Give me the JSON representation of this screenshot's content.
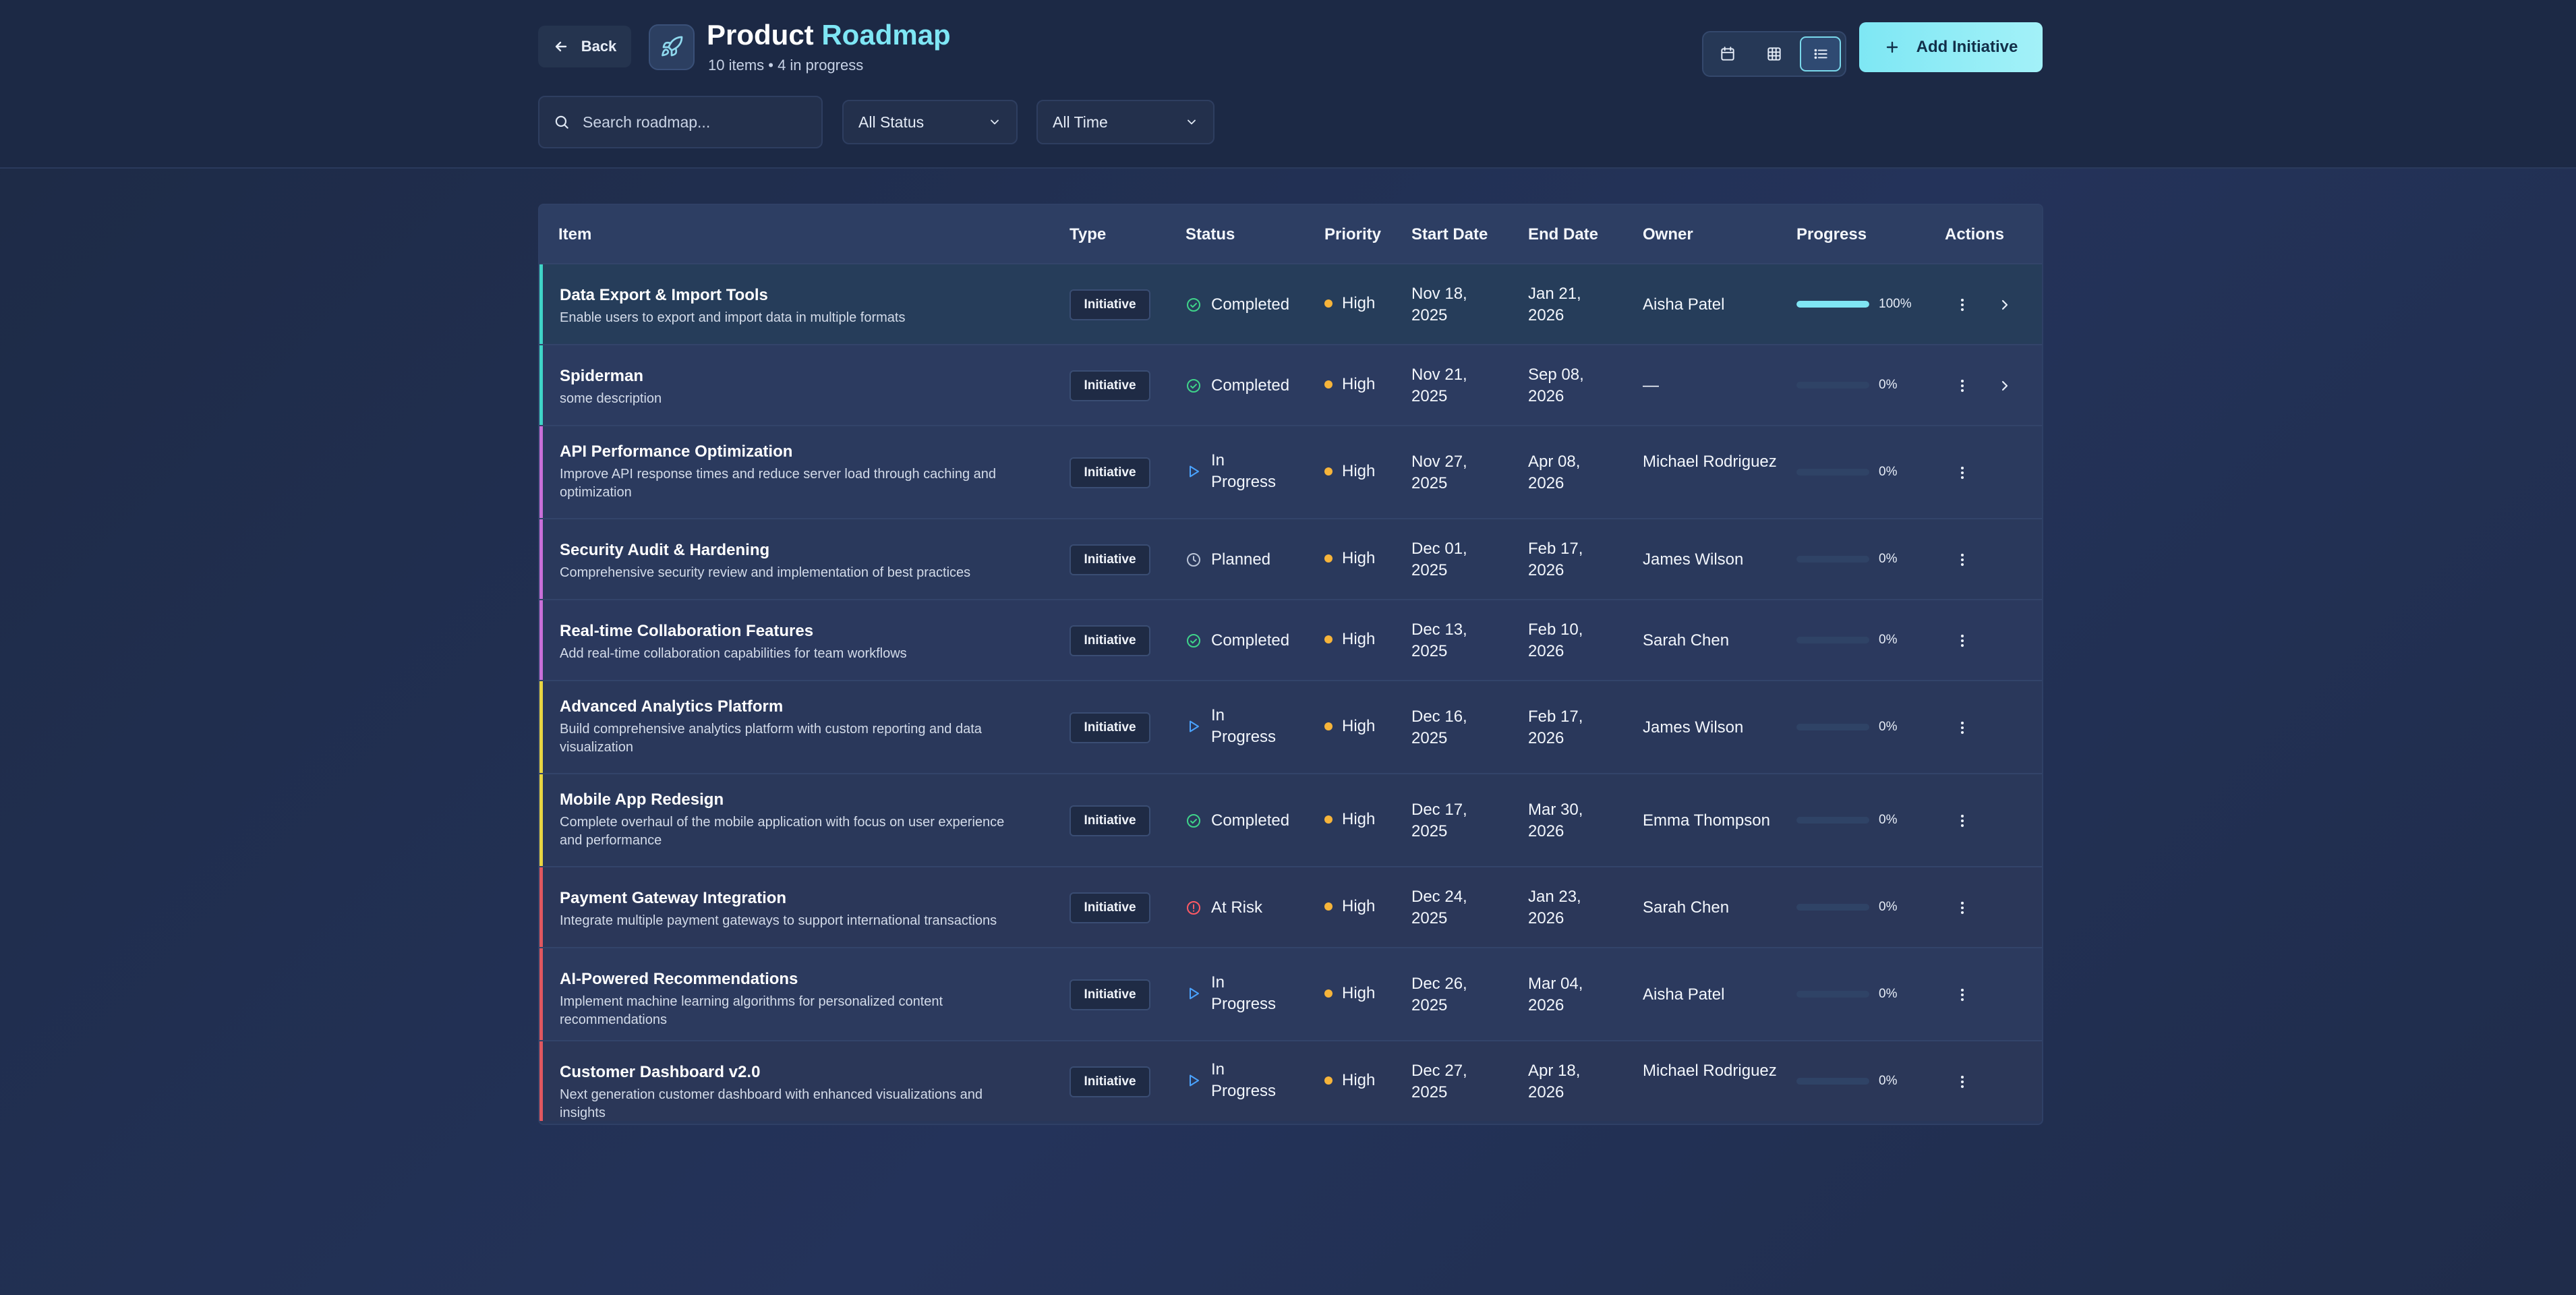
{
  "header": {
    "back_label": "Back",
    "title_main": "Product",
    "title_accent": "Roadmap",
    "subtitle": "10 items • 4 in progress",
    "add_label": "Add Initiative"
  },
  "filters": {
    "search_placeholder": "Search roadmap...",
    "status_value": "All Status",
    "time_value": "All Time"
  },
  "view_toggle": {
    "active": "list"
  },
  "table": {
    "columns": [
      "Item",
      "Type",
      "Status",
      "Priority",
      "Start Date",
      "End Date",
      "Owner",
      "Progress",
      "Actions"
    ],
    "rows": [
      {
        "title": "Data Export & Import Tools",
        "desc": "Enable users to export and import data in multiple formats",
        "type": "Initiative",
        "status": "Completed",
        "status_kind": "completed",
        "priority": "High",
        "start_1": "Nov 18,",
        "start_2": "2025",
        "end_1": "Jan 21,",
        "end_2": "2026",
        "owner": "Aisha Patel",
        "progress": 100,
        "progress_label": "100%",
        "accent": "#3fd4c7",
        "expand": true
      },
      {
        "title": "Spiderman",
        "desc": "some description",
        "type": "Initiative",
        "status": "Completed",
        "status_kind": "completed",
        "priority": "High",
        "start_1": "Nov 21,",
        "start_2": "2025",
        "end_1": "Sep 08,",
        "end_2": "2026",
        "owner": "—",
        "progress": 0,
        "progress_label": "0%",
        "accent": "#3fd4c7",
        "expand": true
      },
      {
        "title": "API Performance Optimization",
        "desc": "Improve API response times and reduce server load through caching and optimization",
        "type": "Initiative",
        "status": "In Progress",
        "status_kind": "progress",
        "priority": "High",
        "start_1": "Nov 27,",
        "start_2": "2025",
        "end_1": "Apr 08,",
        "end_2": "2026",
        "owner": "Michael Rodriguez",
        "progress": 0,
        "progress_label": "0%",
        "accent": "#c86fd8",
        "expand": false
      },
      {
        "title": "Security Audit & Hardening",
        "desc": "Comprehensive security review and implementation of best practices",
        "type": "Initiative",
        "status": "Planned",
        "status_kind": "planned",
        "priority": "High",
        "start_1": "Dec 01,",
        "start_2": "2025",
        "end_1": "Feb 17,",
        "end_2": "2026",
        "owner": "James Wilson",
        "progress": 0,
        "progress_label": "0%",
        "accent": "#c86fd8",
        "expand": false
      },
      {
        "title": "Real-time Collaboration Features",
        "desc": "Add real-time collaboration capabilities for team workflows",
        "type": "Initiative",
        "status": "Completed",
        "status_kind": "completed",
        "priority": "High",
        "start_1": "Dec 13,",
        "start_2": "2025",
        "end_1": "Feb 10,",
        "end_2": "2026",
        "owner": "Sarah Chen",
        "progress": 0,
        "progress_label": "0%",
        "accent": "#c86fd8",
        "expand": false
      },
      {
        "title": "Advanced Analytics Platform",
        "desc": "Build comprehensive analytics platform with custom reporting and data visualization",
        "type": "Initiative",
        "status": "In Progress",
        "status_kind": "progress",
        "priority": "High",
        "start_1": "Dec 16,",
        "start_2": "2025",
        "end_1": "Feb 17,",
        "end_2": "2026",
        "owner": "James Wilson",
        "progress": 0,
        "progress_label": "0%",
        "accent": "#e8d542",
        "expand": false
      },
      {
        "title": "Mobile App Redesign",
        "desc": "Complete overhaul of the mobile application with focus on user experience and performance",
        "type": "Initiative",
        "status": "Completed",
        "status_kind": "completed",
        "priority": "High",
        "start_1": "Dec 17,",
        "start_2": "2025",
        "end_1": "Mar 30,",
        "end_2": "2026",
        "owner": "Emma Thompson",
        "progress": 0,
        "progress_label": "0%",
        "accent": "#e8d542",
        "expand": false
      },
      {
        "title": "Payment Gateway Integration",
        "desc": "Integrate multiple payment gateways to support international transactions",
        "type": "Initiative",
        "status": "At Risk",
        "status_kind": "risk",
        "priority": "High",
        "start_1": "Dec 24,",
        "start_2": "2025",
        "end_1": "Jan 23,",
        "end_2": "2026",
        "owner": "Sarah Chen",
        "progress": 0,
        "progress_label": "0%",
        "accent": "#e0575f",
        "expand": false
      },
      {
        "title": "AI-Powered Recommendations",
        "desc": "Implement machine learning algorithms for personalized content recommendations",
        "type": "Initiative",
        "status": "In Progress",
        "status_kind": "progress",
        "priority": "High",
        "start_1": "Dec 26,",
        "start_2": "2025",
        "end_1": "Mar 04,",
        "end_2": "2026",
        "owner": "Aisha Patel",
        "progress": 0,
        "progress_label": "0%",
        "accent": "#e0575f",
        "expand": false
      },
      {
        "title": "Customer Dashboard v2.0",
        "desc": "Next generation customer dashboard with enhanced visualizations and insights",
        "type": "Initiative",
        "status": "In Progress",
        "status_kind": "progress",
        "priority": "High",
        "start_1": "Dec 27,",
        "start_2": "2025",
        "end_1": "Apr 18,",
        "end_2": "2026",
        "owner": "Michael Rodriguez",
        "progress": 0,
        "progress_label": "0%",
        "accent": "#e0575f",
        "expand": false
      }
    ]
  },
  "colors": {
    "accent": "#7ee6f5",
    "completed": "#3fd48a",
    "progress": "#4aa3ff",
    "planned": "#b9c3d6",
    "risk": "#ff5a64",
    "priority_high": "#f6b43a"
  }
}
